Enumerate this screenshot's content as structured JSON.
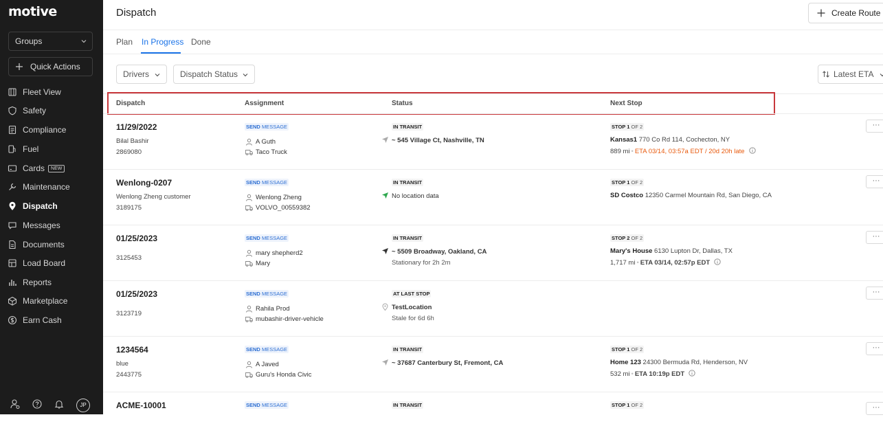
{
  "app": {
    "logo": "motive"
  },
  "sidebar": {
    "groups_label": "Groups",
    "quick_actions_label": "Quick Actions",
    "items": [
      {
        "label": "Fleet View",
        "icon": "map-icon"
      },
      {
        "label": "Safety",
        "icon": "shield-icon"
      },
      {
        "label": "Compliance",
        "icon": "document-icon"
      },
      {
        "label": "Fuel",
        "icon": "fuel-pump-icon"
      },
      {
        "label": "Cards",
        "icon": "card-icon",
        "badge": "NEW"
      },
      {
        "label": "Maintenance",
        "icon": "wrench-icon"
      },
      {
        "label": "Dispatch",
        "icon": "location-pin-icon",
        "active": true
      },
      {
        "label": "Messages",
        "icon": "chat-icon"
      },
      {
        "label": "Documents",
        "icon": "file-icon"
      },
      {
        "label": "Load Board",
        "icon": "board-icon"
      },
      {
        "label": "Reports",
        "icon": "bar-chart-icon"
      },
      {
        "label": "Marketplace",
        "icon": "cube-icon"
      },
      {
        "label": "Earn Cash",
        "icon": "dollar-icon"
      }
    ],
    "footer": {
      "avatar_initials": "JP"
    }
  },
  "header": {
    "title": "Dispatch",
    "create_button": "Create Route",
    "tabs": [
      "Plan",
      "In Progress",
      "Done"
    ],
    "active_tab": "In Progress"
  },
  "filters": {
    "drivers": "Drivers",
    "dispatch_status": "Dispatch Status",
    "sort": "Latest ETA"
  },
  "table": {
    "columns": [
      "Dispatch",
      "Assignment",
      "Status",
      "Next Stop"
    ],
    "send_label": "SEND",
    "message_label": "MESSAGE",
    "more_label": "···",
    "rows": [
      {
        "dispatch_title": "11/29/2022",
        "dispatch_line2": "Bilal Bashir",
        "dispatch_line3": "2869080",
        "driver": "A Guth",
        "vehicle": "Taco Truck",
        "status": "IN TRANSIT",
        "location": "~ 545 Village Ct, Nashville, TN",
        "location_sub": "",
        "stop_prefix": "STOP",
        "stop_num": "1",
        "stop_of": "OF 2",
        "stop_name": "Kansas1",
        "stop_addr": "770 Co Rd 114, Cochecton, NY",
        "distance": "889 mi",
        "eta": "ETA 03/14, 03:57a EDT",
        "late": "/ 20d 20h late"
      },
      {
        "dispatch_title": "Wenlong-0207",
        "dispatch_line2": "Wenlong Zheng customer",
        "dispatch_line3": "3189175",
        "driver": "Wenlong Zheng",
        "vehicle": "VOLVO_00559382",
        "status": "IN TRANSIT",
        "location": "No location data",
        "location_sub": "",
        "stop_prefix": "STOP",
        "stop_num": "1",
        "stop_of": "OF 2",
        "stop_name": "SD Costco",
        "stop_addr": "12350 Carmel Mountain Rd, San Diego, CA",
        "distance": "",
        "eta": "",
        "late": ""
      },
      {
        "dispatch_title": "01/25/2023",
        "dispatch_line2": "3125453",
        "dispatch_line3": "",
        "driver": "mary shepherd2",
        "vehicle": "Mary",
        "status": "IN TRANSIT",
        "location": "~ 5509 Broadway, Oakland, CA",
        "location_sub": "Stationary for 2h 2m",
        "stop_prefix": "STOP",
        "stop_num": "2",
        "stop_of": "OF 2",
        "stop_name": "Mary's House",
        "stop_addr": "6130 Lupton Dr, Dallas, TX",
        "distance": "1,717 mi",
        "eta": "ETA 03/14, 02:57p EDT",
        "late": ""
      },
      {
        "dispatch_title": "01/25/2023",
        "dispatch_line2": "3123719",
        "dispatch_line3": "",
        "driver": "Rahila Prod",
        "vehicle": "mubashir-driver-vehicle",
        "status": "AT LAST STOP",
        "location": "TestLocation",
        "location_sub": "Stale for 6d 6h",
        "stop_prefix": "",
        "stop_num": "",
        "stop_of": "",
        "stop_name": "",
        "stop_addr": "",
        "distance": "",
        "eta": "",
        "late": ""
      },
      {
        "dispatch_title": "1234564",
        "dispatch_line2": "blue",
        "dispatch_line3": "2443775",
        "driver": "A Javed",
        "vehicle": "Guru's Honda Civic",
        "status": "IN TRANSIT",
        "location": "~ 37687 Canterbury St, Fremont, CA",
        "location_sub": "",
        "stop_prefix": "STOP",
        "stop_num": "1",
        "stop_of": "OF 2",
        "stop_name": "Home 123",
        "stop_addr": "24300 Bermuda Rd, Henderson, NV",
        "distance": "532 mi",
        "eta": "ETA 10:19p EDT",
        "late": ""
      },
      {
        "dispatch_title": "ACME-10001",
        "dispatch_line2": "",
        "dispatch_line3": "",
        "driver": "",
        "vehicle": "",
        "status": "IN TRANSIT",
        "location": "",
        "location_sub": "",
        "stop_prefix": "STOP",
        "stop_num": "1",
        "stop_of": "OF 2",
        "stop_name": "",
        "stop_addr": "",
        "distance": "",
        "eta": "",
        "late": ""
      }
    ]
  }
}
